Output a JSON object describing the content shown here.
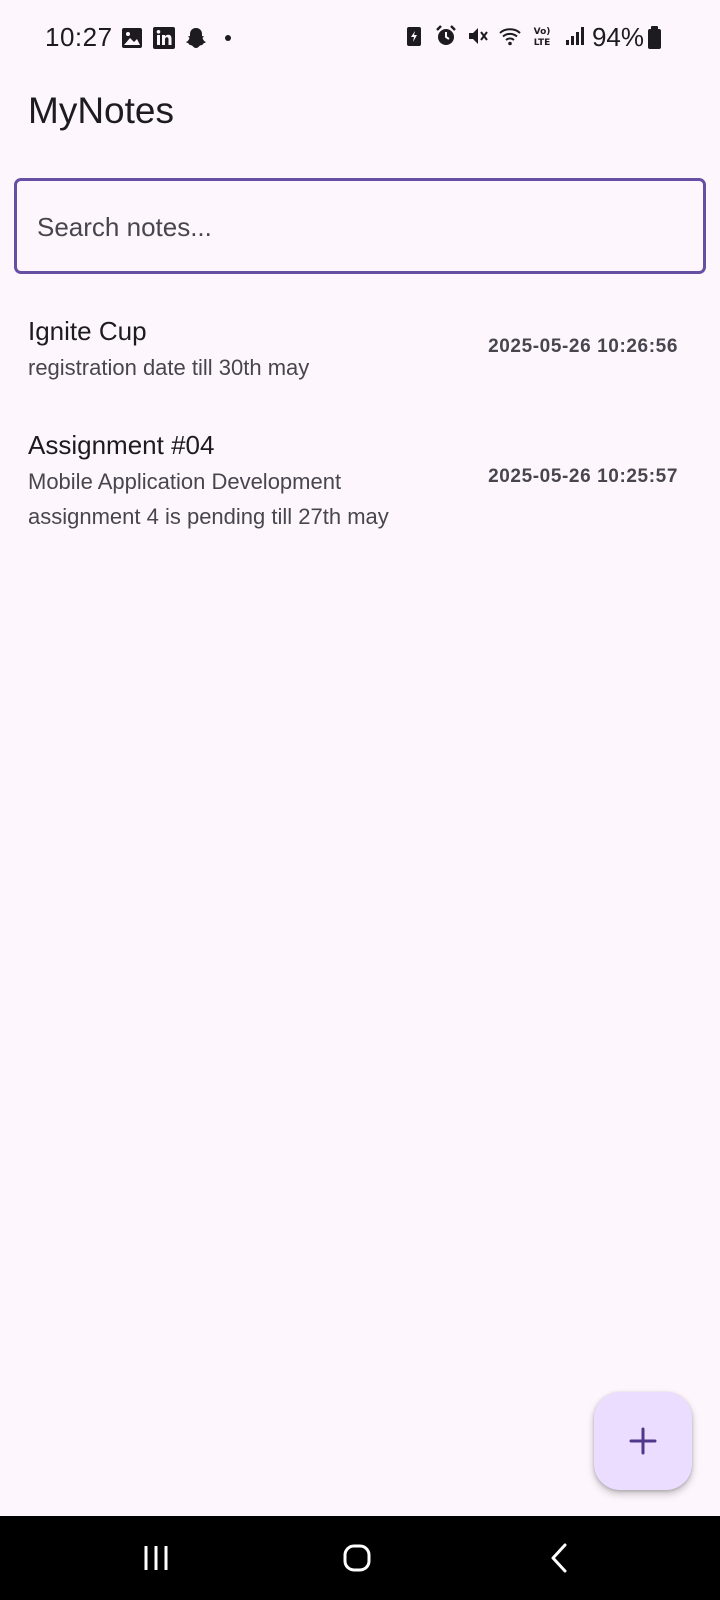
{
  "status_bar": {
    "time": "10:27",
    "left_icons": [
      "gallery-icon",
      "linkedin-icon",
      "snapchat-icon",
      "dot-icon"
    ],
    "right_icons": [
      "battery-saver-icon",
      "alarm-icon",
      "mute-icon",
      "wifi-icon",
      "volte-icon",
      "signal-icon"
    ],
    "battery_percent": "94%"
  },
  "app": {
    "title": "MyNotes"
  },
  "search": {
    "placeholder": "Search notes...",
    "value": ""
  },
  "notes": [
    {
      "title": "Ignite Cup",
      "body": "registration date till 30th may",
      "date": "2025-05-26 10:26:56"
    },
    {
      "title": "Assignment #04",
      "body": "Mobile Application Development assignment 4 is pending till 27th may",
      "date": "2025-05-26 10:25:57"
    }
  ],
  "fab": {
    "icon": "plus-icon",
    "color": "#eaddff",
    "icon_color": "#4f378b"
  },
  "nav_bar": {
    "buttons": [
      "recent-apps-icon",
      "home-icon",
      "back-icon"
    ]
  },
  "colors": {
    "background": "#fdf7fd",
    "accent": "#6750a4",
    "text_primary": "#1d1b20",
    "text_secondary": "#49454f"
  }
}
